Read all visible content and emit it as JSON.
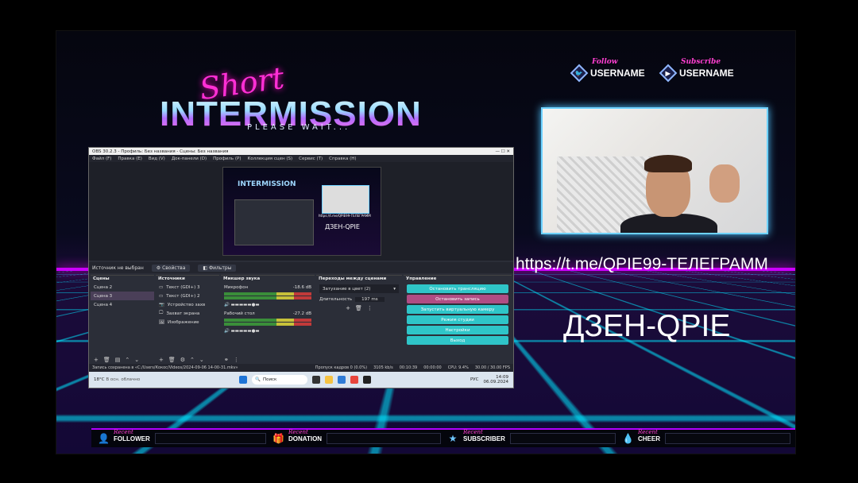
{
  "overlay": {
    "logo_script": "Short",
    "logo_main": "INTERMISSION",
    "logo_sub": "PLEASE WAIT...",
    "follow_label": "Follow",
    "follow_user": "USERNAME",
    "subscribe_label": "Subscribe",
    "subscribe_user": "USERNAME",
    "url_text": "https://t.me/QPIE99-ТЕЛЕГРАММ",
    "dzen_text": "ДЗЕН-QPIE",
    "alerts": [
      {
        "label": "FOLLOWER",
        "prefix": "Recent"
      },
      {
        "label": "DONATION",
        "prefix": "Recent"
      },
      {
        "label": "SUBSCRIBER",
        "prefix": "Recent"
      },
      {
        "label": "CHEER",
        "prefix": "Recent"
      }
    ],
    "colors": {
      "neon_pink": "#ff2fd5",
      "neon_cyan": "#00e6ff",
      "purple_line": "#b200ff"
    }
  },
  "obs": {
    "title": "OBS 30.2.3 - Профиль: Без названия - Сцены: Без названия",
    "menu": [
      "Файл (F)",
      "Правка (E)",
      "Вид (V)",
      "Док-панели (D)",
      "Профиль (P)",
      "Коллекция сцен (S)",
      "Сервис (T)",
      "Справка (H)"
    ],
    "preview_mini_title": "INTERMISSION",
    "preview_mini_url": "https://t.me/QPIE99-ТЕЛЕГРАММ",
    "preview_mini_dzen": "ДЗЕН-QPIE",
    "source_status": "Источник не выбран",
    "properties_btn": "Свойства",
    "filters_btn": "Фильтры",
    "scenes_header": "Сцены",
    "scenes": [
      "Сцена 2",
      "Сцена 3",
      "Сцена 4"
    ],
    "sources_header": "Источники",
    "sources": [
      "Текст (GDI+) 3",
      "Текст (GDI+) 2",
      "Устройство захв",
      "Захват экрана",
      "Изображение"
    ],
    "mixer_header": "Микшер звука",
    "mixer": [
      {
        "name": "Микрофон",
        "db": "-18.6 dB"
      },
      {
        "name": "Рабочий стол",
        "db": "-27.2 dB"
      }
    ],
    "transitions_header": "Переходы между сценами",
    "transition_value": "Затухание в цвет (2)",
    "duration_label": "Длительность",
    "duration_value": "197 ms",
    "controls_header": "Управление",
    "controls": [
      "Остановить трансляцию",
      "Остановить запись",
      "Запустить виртуальную камеру",
      "Режим студии",
      "Настройки",
      "Выход"
    ],
    "status_left": "Запись сохранена в «C:/Users/Кокос/Videos/2024-09-06 14-00-31.mkv»",
    "status_dropped": "Пропуск кадров 0 (0.0%)",
    "status_kbps": "3105 kb/s",
    "status_live": "00:10:39",
    "status_rec": "00:00:00",
    "status_cpu": "CPU: 9.4%",
    "status_fps": "30.00 / 30.00 FPS",
    "taskbar_weather": "18°C",
    "taskbar_weather_sub": "В осн. облачно",
    "taskbar_search": "Поиск",
    "taskbar_lang": "РУС",
    "taskbar_time": "14:09",
    "taskbar_date": "06.09.2024"
  }
}
